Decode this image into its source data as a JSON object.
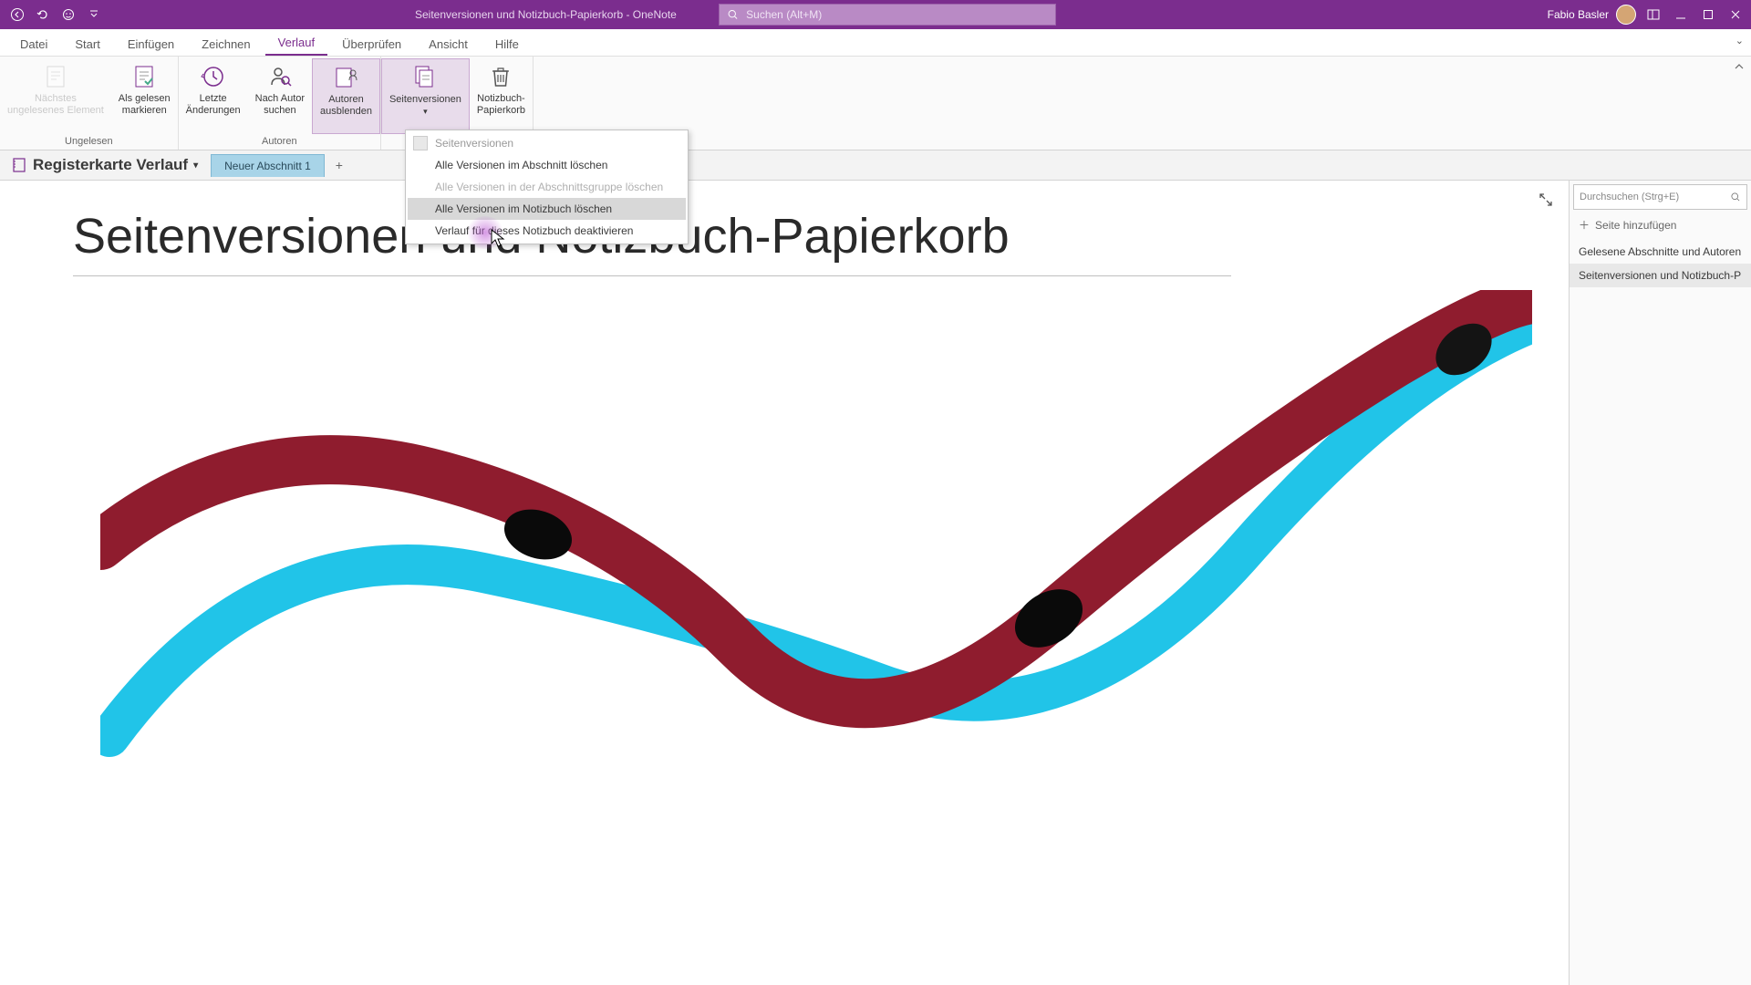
{
  "titlebar": {
    "title": "Seitenversionen und Notizbuch-Papierkorb  -  OneNote",
    "search_placeholder": "Suchen (Alt+M)",
    "user": "Fabio Basler"
  },
  "tabs": {
    "datei": "Datei",
    "start": "Start",
    "einfuegen": "Einfügen",
    "zeichnen": "Zeichnen",
    "verlauf": "Verlauf",
    "ueberpruefen": "Überprüfen",
    "ansicht": "Ansicht",
    "hilfe": "Hilfe"
  },
  "ribbon": {
    "ungelesen": {
      "naechstes": "Nächstes\nungelesenes Element",
      "als_gelesen": "Als gelesen\nmarkieren",
      "group": "Ungelesen"
    },
    "autoren": {
      "letzte": "Letzte\nÄnderungen",
      "nach_autor": "Nach Autor\nsuchen",
      "ausblenden": "Autoren\nausblenden",
      "group": "Autoren"
    },
    "verlauf": {
      "seitenversionen": "Seitenversionen",
      "papierkorb": "Notizbuch-\nPapierkorb"
    }
  },
  "dropdown": {
    "header": "Seitenversionen",
    "i1": "Alle Versionen im Abschnitt löschen",
    "i2": "Alle Versionen in der Abschnittsgruppe löschen",
    "i3": "Alle Versionen im Notizbuch löschen",
    "i4": "Verlauf für dieses Notizbuch deaktivieren"
  },
  "notebook": {
    "name": "Registerkarte Verlauf",
    "section": "Neuer Abschnitt 1"
  },
  "page": {
    "title": "Seitenversionen und Notizbuch-Papierkorb"
  },
  "panel": {
    "search": "Durchsuchen (Strg+E)",
    "add": "Seite hinzufügen",
    "p1": "Gelesene Abschnitte und Autoren",
    "p2": "Seitenversionen und Notizbuch-P"
  }
}
